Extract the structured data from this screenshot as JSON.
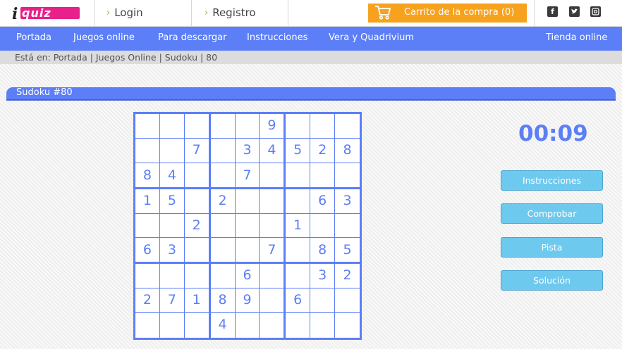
{
  "header": {
    "logo_text": "iquiz",
    "login_label": "Login",
    "register_label": "Registro",
    "cart_label": "Carrito de la compra (0)",
    "social": [
      "facebook-icon",
      "twitter-icon",
      "instagram-icon"
    ]
  },
  "nav": {
    "items": [
      "Portada",
      "Juegos online",
      "Para descargar",
      "Instrucciones",
      "Vera y Quadrivium"
    ],
    "shop_label": "Tienda online"
  },
  "breadcrumb": "Está en: Portada | Juegos Online | Sudoku | 80",
  "title": "Sudoku #80",
  "timer": "00:09",
  "buttons": {
    "instrucciones": "Instrucciones",
    "comprobar": "Comprobar",
    "pista": "Pista",
    "solucion": "Solución"
  },
  "grid": [
    [
      "",
      "",
      "",
      "",
      "",
      "9",
      "",
      "",
      ""
    ],
    [
      "",
      "",
      "7",
      "",
      "3",
      "4",
      "5",
      "2",
      "8"
    ],
    [
      "8",
      "4",
      "",
      "",
      "7",
      "",
      "",
      "",
      ""
    ],
    [
      "1",
      "5",
      "",
      "2",
      "",
      "",
      "",
      "6",
      "3"
    ],
    [
      "",
      "",
      "2",
      "",
      "",
      "",
      "1",
      "",
      ""
    ],
    [
      "6",
      "3",
      "",
      "",
      "",
      "7",
      "",
      "8",
      "5"
    ],
    [
      "",
      "",
      "",
      "",
      "6",
      "",
      "",
      "3",
      "2"
    ],
    [
      "2",
      "7",
      "1",
      "8",
      "9",
      "",
      "6",
      "",
      ""
    ],
    [
      "",
      "",
      "",
      "4",
      "",
      "",
      "",
      "",
      ""
    ]
  ],
  "colors": {
    "accent": "#5c7ef7",
    "cart": "#f7a21e",
    "button": "#6ec9ee",
    "logo": "#e8208a"
  }
}
